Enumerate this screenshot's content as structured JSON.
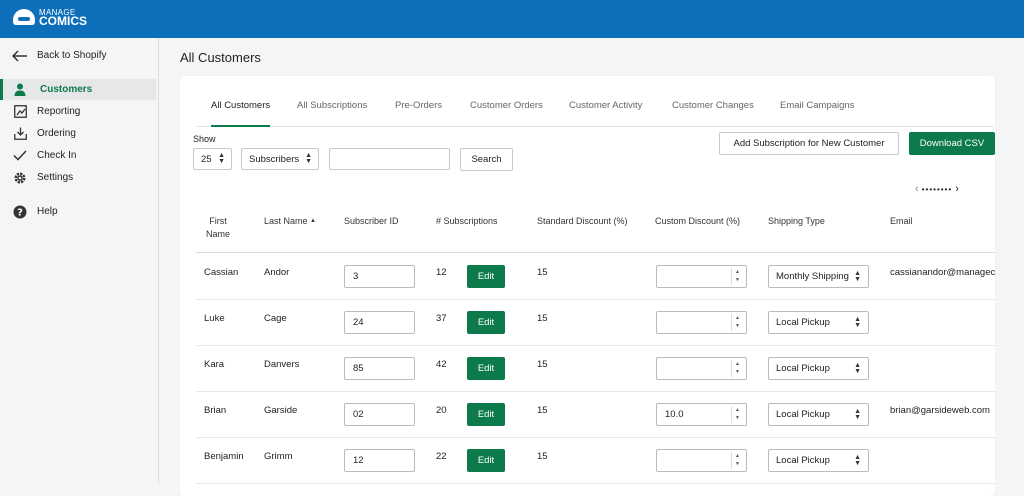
{
  "app": {
    "logo_top": "MANAGE",
    "logo_bottom": "COMICS"
  },
  "sidebar": {
    "back_label": "Back to Shopify",
    "items": [
      {
        "label": "Customers",
        "icon": "person-icon"
      },
      {
        "label": "Reporting",
        "icon": "reporting-icon"
      },
      {
        "label": "Ordering",
        "icon": "download-tray-icon"
      },
      {
        "label": "Check In",
        "icon": "checkmark-icon"
      },
      {
        "label": "Settings",
        "icon": "gear-icon"
      },
      {
        "label": "Help",
        "icon": "help-icon"
      }
    ]
  },
  "main": {
    "title": "All Customers",
    "tabs": [
      "All Customers",
      "All Subscriptions",
      "Pre-Orders",
      "Customer Orders",
      "Customer Activity",
      "Customer Changes",
      "Email Campaigns"
    ],
    "show_label": "Show",
    "page_size": "25",
    "filter_value": "Subscribers",
    "search_value": "",
    "search_button": "Search",
    "add_subscription_button": "Add Subscription for New Customer",
    "download_csv_button": "Download CSV",
    "pager": {
      "prev": "‹",
      "dots": "••••••••",
      "next": "›"
    }
  },
  "table": {
    "columns": [
      "First Name",
      "Last Name",
      "Subscriber ID",
      "# Subscriptions",
      "Standard Discount (%)",
      "Custom Discount (%)",
      "Shipping Type",
      "Email"
    ],
    "sort_indicator": "▲",
    "edit_label": "Edit",
    "rows": [
      {
        "first": "Cassian",
        "last": "Andor",
        "subscriber_id": "3",
        "subscriptions": "12",
        "standard_discount": "15",
        "custom_discount": "",
        "shipping": "Monthly Shipping",
        "email": "cassianandor@manageco"
      },
      {
        "first": "Luke",
        "last": "Cage",
        "subscriber_id": "24",
        "subscriptions": "37",
        "standard_discount": "15",
        "custom_discount": "",
        "shipping": "Local Pickup",
        "email": ""
      },
      {
        "first": "Kara",
        "last": "Danvers",
        "subscriber_id": "85",
        "subscriptions": "42",
        "standard_discount": "15",
        "custom_discount": "",
        "shipping": "Local Pickup",
        "email": ""
      },
      {
        "first": "Brian",
        "last": "Garside",
        "subscriber_id": "02",
        "subscriptions": "20",
        "standard_discount": "15",
        "custom_discount": "10.0",
        "shipping": "Local Pickup",
        "email": "brian@garsideweb.com"
      },
      {
        "first": "Benjamin",
        "last": "Grimm",
        "subscriber_id": "12",
        "subscriptions": "22",
        "standard_discount": "15",
        "custom_discount": "",
        "shipping": "Local Pickup",
        "email": ""
      }
    ]
  },
  "colors": {
    "brand_blue": "#0d6fba",
    "accent_green": "#0d7a4c"
  }
}
